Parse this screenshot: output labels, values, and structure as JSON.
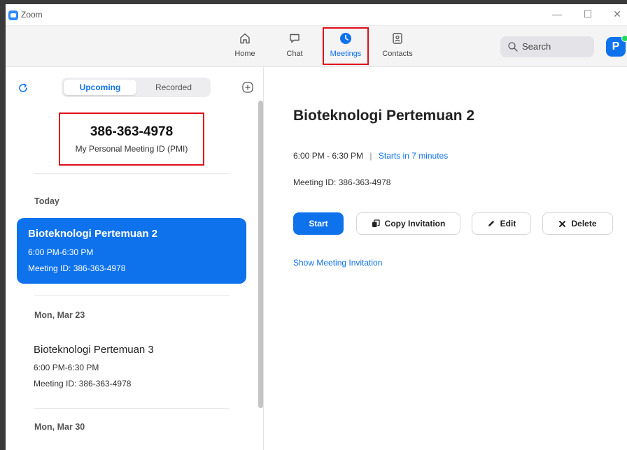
{
  "window": {
    "title": "Zoom",
    "minimize": "—",
    "maximize": "☐",
    "close": "✕"
  },
  "nav": {
    "tabs": [
      {
        "label": "Home",
        "icon": "home-icon"
      },
      {
        "label": "Chat",
        "icon": "chat-icon"
      },
      {
        "label": "Meetings",
        "icon": "clock-icon",
        "active": true
      },
      {
        "label": "Contacts",
        "icon": "contacts-icon"
      }
    ],
    "search_label": "Search",
    "avatar_initial": "P"
  },
  "left": {
    "segments": {
      "upcoming": "Upcoming",
      "recorded": "Recorded"
    },
    "pmi": {
      "id": "386-363-4978",
      "label": "My Personal Meeting ID (PMI)"
    },
    "groups": [
      {
        "label": "Today",
        "meeting": {
          "title": "Bioteknologi Pertemuan 2",
          "time": "6:00 PM-6:30 PM",
          "id": "Meeting ID: 386-363-4978"
        }
      },
      {
        "label": "Mon, Mar 23",
        "meeting": {
          "title": "Bioteknologi Pertemuan 3",
          "time": "6:00 PM-6:30 PM",
          "id": "Meeting ID: 386-363-4978"
        }
      },
      {
        "label": "Mon, Mar 30"
      }
    ]
  },
  "detail": {
    "title": "Bioteknologi Pertemuan 2",
    "time": "6:00 PM - 6:30 PM",
    "separator": "|",
    "starts": "Starts in 7 minutes",
    "meeting_id": "Meeting ID: 386-363-4978",
    "buttons": {
      "start": "Start",
      "copy": "Copy Invitation",
      "edit": "Edit",
      "delete": "Delete"
    },
    "show_invitation": "Show Meeting Invitation"
  },
  "colors": {
    "accent": "#0E72ED",
    "highlight": "#e0101a",
    "presence": "#23d959"
  }
}
